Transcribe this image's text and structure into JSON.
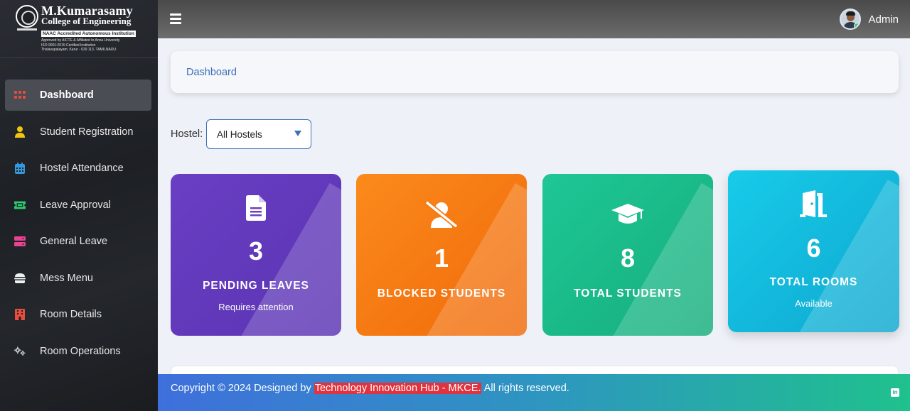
{
  "logo": {
    "name": "M.Kumarasamy",
    "subtitle": "College of Engineering",
    "accreditation": "NAAC Accredited Autonomous Institution",
    "line1": "Approved by AICTE & Affiliated to Anna University",
    "line2": "ISO 9001:2015 Certified Institution",
    "line3": "Thalavapalayam, Karur - 639 113, TAMILNADU."
  },
  "sidebar": {
    "items": [
      {
        "label": "Dashboard",
        "icon": "dashboard-grid-icon",
        "color": "#e74c3c",
        "active": true
      },
      {
        "label": "Student Registration",
        "icon": "user-icon",
        "color": "#f1c40f"
      },
      {
        "label": "Hostel Attendance",
        "icon": "calendar-icon",
        "color": "#3498db"
      },
      {
        "label": "Leave Approval",
        "icon": "ticket-icon",
        "color": "#2ecc71"
      },
      {
        "label": "General Leave",
        "icon": "server-icon",
        "color": "#e84393"
      },
      {
        "label": "Mess Menu",
        "icon": "burger-icon",
        "color": "#ecf0f1"
      },
      {
        "label": "Room Details",
        "icon": "building-icon",
        "color": "#e74c3c"
      },
      {
        "label": "Room Operations",
        "icon": "cogs-icon",
        "color": "#bdc3c7"
      }
    ]
  },
  "topbar": {
    "user": "Admin"
  },
  "breadcrumb": {
    "label": "Dashboard"
  },
  "filter": {
    "label": "Hostel:",
    "selected": "All Hostels"
  },
  "cards": [
    {
      "value": "3",
      "label": "PENDING LEAVES",
      "sub": "Requires attention",
      "icon": "file-icon"
    },
    {
      "value": "1",
      "label": "BLOCKED STUDENTS",
      "sub": "",
      "icon": "user-slash-icon"
    },
    {
      "value": "8",
      "label": "TOTAL STUDENTS",
      "sub": "",
      "icon": "graduation-cap-icon"
    },
    {
      "value": "6",
      "label": "TOTAL ROOMS",
      "sub": "Available",
      "icon": "door-icon"
    }
  ],
  "footer": {
    "prefix": "Copyright © 2024 Designed by",
    "highlight": "Technology Innovation Hub - MKCE.",
    "suffix": "All rights reserved.",
    "social": "in"
  }
}
